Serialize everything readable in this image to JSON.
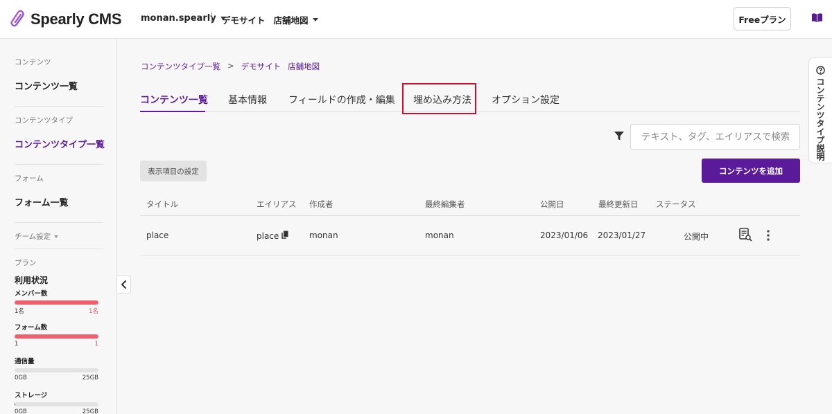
{
  "header": {
    "logo_text": "Spearly CMS",
    "team_name": "monan.spearly",
    "site_name": "デモサイト",
    "content_type_name": "店舗地図",
    "plan_button": "Freeプラン",
    "colors": {
      "brand": "#5a1a9a",
      "logo_gradient_start": "#e05aa6",
      "logo_gradient_end": "#6a4ef0"
    }
  },
  "sidebar": {
    "contents_section": "コンテンツ",
    "contents_list": "コンテンツ一覧",
    "content_types_section": "コンテンツタイプ",
    "content_types_list": "コンテンツタイプ一覧",
    "forms_section": "フォーム",
    "forms_list": "フォーム一覧",
    "team_settings": "チーム設定",
    "plan_section": "プラン",
    "usage_title": "利用状況",
    "meters": [
      {
        "label": "メンバー数",
        "min": "1名",
        "max": "1名",
        "fill": 1.0
      },
      {
        "label": "フォーム数",
        "min": "1",
        "max": "1",
        "fill": 1.0
      },
      {
        "label": "通信量",
        "min": "0GB",
        "max": "25GB",
        "fill": 0.0
      },
      {
        "label": "ストレージ",
        "min": "0GB",
        "max": "25GB",
        "fill": 0.01
      }
    ]
  },
  "breadcrumb": {
    "root": "コンテンツタイプ一覧",
    "separator": ">",
    "site": "デモサイト",
    "content_type": "店舗地図"
  },
  "tabs": [
    {
      "label": "コンテンツ一覧",
      "active": true
    },
    {
      "label": "基本情報",
      "active": false
    },
    {
      "label": "フィールドの作成・編集",
      "active": false
    },
    {
      "label": "埋め込み方法",
      "active": false,
      "highlighted": true
    },
    {
      "label": "オプション設定",
      "active": false
    }
  ],
  "search": {
    "placeholder": "テキスト、タグ、エイリアスで検索",
    "value": ""
  },
  "toolbar": {
    "display_settings": "表示項目の設定",
    "add_content": "コンテンツを追加"
  },
  "table": {
    "columns": [
      "タイトル",
      "エイリアス",
      "作成者",
      "最終編集者",
      "公開日",
      "最終更新日",
      "ステータス"
    ],
    "rows": [
      {
        "title": "place",
        "alias": "place",
        "author": "monan",
        "last_editor": "monan",
        "published": "2023/01/06",
        "updated": "2023/01/27",
        "status": "公開中"
      }
    ]
  },
  "help_tab": {
    "label": "コンテンツタイプ説明"
  },
  "icons": [
    "logo-icon",
    "book-icon",
    "filter-icon",
    "copy-icon",
    "preview-icon",
    "more-icon",
    "chevron-left-icon",
    "help-icon"
  ]
}
